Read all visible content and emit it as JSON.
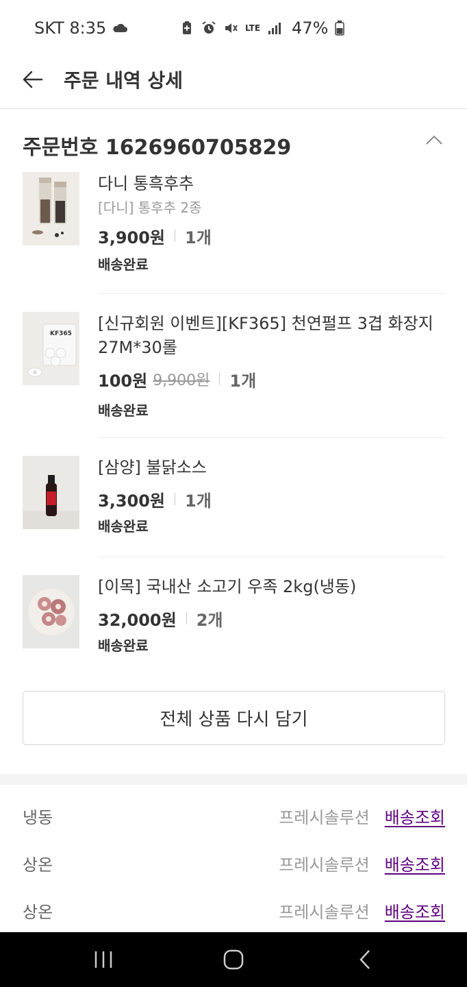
{
  "status_bar": {
    "carrier_time": "SKT 8:35",
    "network": "LTE",
    "battery": "47%"
  },
  "header": {
    "title": "주문 내역 상세"
  },
  "order": {
    "label": "주문번호 1626960705829"
  },
  "items": [
    {
      "name": "다니 통흑후추",
      "option": "[다니] 통후추 2종",
      "price": "3,900원",
      "original_price": "",
      "qty": "1개",
      "status": "배송완료"
    },
    {
      "name": "[신규회원 이벤트][KF365] 천연펄프 3겹 화장지 27M*30롤",
      "option": "",
      "price": "100원",
      "original_price": "9,900원",
      "qty": "1개",
      "status": "배송완료"
    },
    {
      "name": "[삼양] 불닭소스",
      "option": "",
      "price": "3,300원",
      "original_price": "",
      "qty": "1개",
      "status": "배송완료"
    },
    {
      "name": "[이목] 국내산 소고기 우족 2kg(냉동)",
      "option": "",
      "price": "32,000원",
      "original_price": "",
      "qty": "2개",
      "status": "배송완료"
    }
  ],
  "reorder_button": "전체 상품 다시 담기",
  "shipments": [
    {
      "type": "냉동",
      "carrier": "프레시솔루션",
      "track": "배송조회"
    },
    {
      "type": "상온",
      "carrier": "프레시솔루션",
      "track": "배송조회"
    },
    {
      "type": "상온",
      "carrier": "프레시솔루션",
      "track": "배송조회"
    }
  ],
  "colors": {
    "accent_purple": "#5f0080",
    "text_dark": "#333333",
    "text_grey": "#999999"
  },
  "icons": [
    "cloud-icon",
    "battery-saver-icon",
    "alarm-icon",
    "mute-icon",
    "lte-icon",
    "signal-icon",
    "battery-icon",
    "back-arrow-icon",
    "chevron-up-icon",
    "recent-apps-icon",
    "home-icon",
    "nav-back-icon"
  ]
}
